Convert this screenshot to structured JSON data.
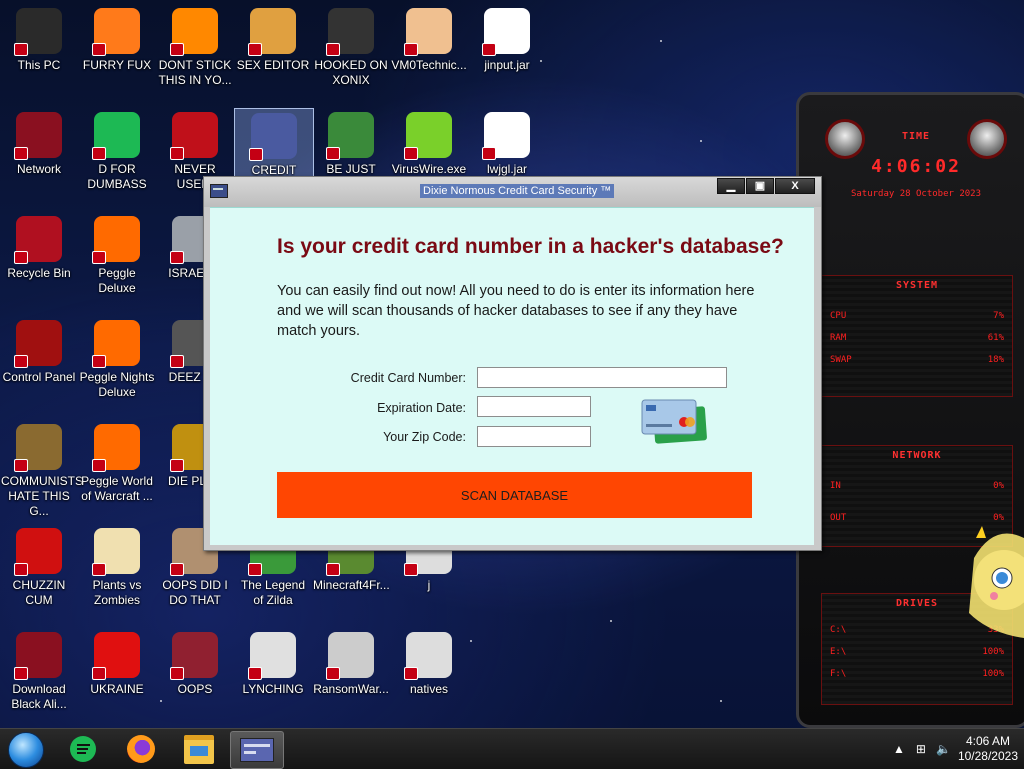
{
  "desktop": {
    "icons": [
      {
        "label": "This PC",
        "icon": "computer-icon",
        "color": "#2a2a2a"
      },
      {
        "label": "FURRY FUX",
        "icon": "firefox-icon",
        "color": "#ff7a1a"
      },
      {
        "label": "DONT STICK THIS IN YO...",
        "icon": "vlc-cone-icon",
        "color": "#ff8800"
      },
      {
        "label": "SEX EDITOR",
        "icon": "hxd-editor-icon",
        "color": "#e0a040"
      },
      {
        "label": "HOOKED ON XONIX",
        "icon": "xonix-game-icon",
        "color": "#333333"
      },
      {
        "label": "VM0Technic...",
        "icon": "doctor-person-icon",
        "color": "#f0c090"
      },
      {
        "label": "jinput.jar",
        "icon": "java-jar-icon",
        "color": "#ffffff"
      },
      {
        "label": "Network",
        "icon": "network-orb-icon",
        "color": "#8a1020"
      },
      {
        "label": "D FOR DUMBASS",
        "icon": "d-green-icon",
        "color": "#1db954"
      },
      {
        "label": "NEVER USED!",
        "icon": "dev-cpp-icon",
        "color": "#c0101a"
      },
      {
        "label": "CREDIT CARD CHECKER",
        "icon": "credit-card-checker-icon",
        "color": "#4a5aa0"
      },
      {
        "label": "BE JUST LIKE THE DUDE!",
        "icon": "santa-elf-icon",
        "color": "#3a8a3a"
      },
      {
        "label": "VirusWire.exe",
        "icon": "lime-wheel-icon",
        "color": "#7ad02a"
      },
      {
        "label": "lwjgl.jar",
        "icon": "java-jar-icon",
        "color": "#ffffff"
      },
      {
        "label": "Recycle Bin",
        "icon": "recycle-bin-icon",
        "color": "#b01020"
      },
      {
        "label": "Peggle Deluxe",
        "icon": "peggle-icon",
        "color": "#ff6a00"
      },
      {
        "label": "ISRAEL S",
        "icon": "gun-icon",
        "color": "#9aa0a8"
      },
      {
        "label": "Control Panel",
        "icon": "control-panel-icon",
        "color": "#a01010"
      },
      {
        "label": "Peggle Nights Deluxe",
        "icon": "peggle-nights-icon",
        "color": "#ff6a00"
      },
      {
        "label": "DEEZ NU",
        "icon": "layers-icon",
        "color": "#555555"
      },
      {
        "label": "COMMUNISTS HATE THIS G...",
        "icon": "money-bag-icon",
        "color": "#8a6a30"
      },
      {
        "label": "Peggle World of Warcraft ...",
        "icon": "peggle-wow-icon",
        "color": "#ff6a00"
      },
      {
        "label": "DIE PLEA",
        "icon": "de-logo-icon",
        "color": "#c09010"
      },
      {
        "label": "CHUZZIN CUM",
        "icon": "chuzzle-icon",
        "color": "#d01010"
      },
      {
        "label": "Plants vs Zombies",
        "icon": "flower-icon",
        "color": "#f0e0b0"
      },
      {
        "label": "OOPS DID I DO THAT",
        "icon": "portrait-icon",
        "color": "#b09070"
      },
      {
        "label": "The Legend of Zilda",
        "icon": "link-sprite-icon",
        "color": "#3a9a3a"
      },
      {
        "label": "Minecraft4Fr...",
        "icon": "minecraft-icon",
        "color": "#5a8a30"
      },
      {
        "label": "j",
        "icon": "file-icon",
        "color": "#dddddd"
      },
      {
        "label": "Download Black Ali...",
        "icon": "alien-orb-icon",
        "color": "#8a1020"
      },
      {
        "label": "UKRAINE",
        "icon": "radiation-icon",
        "color": "#e01010"
      },
      {
        "label": "OOPS",
        "icon": "card-icon",
        "color": "#902030"
      },
      {
        "label": "LYNCHING",
        "icon": "noose-icon",
        "color": "#e0e0e0"
      },
      {
        "label": "RansomWar...",
        "icon": "skull-icon",
        "color": "#cccccc"
      },
      {
        "label": "natives",
        "icon": "file-icon",
        "color": "#dddddd"
      }
    ]
  },
  "widget": {
    "time_title": "TIME",
    "time": "4:06:02",
    "date": "Saturday 28 October 2023",
    "system_title": "SYSTEM",
    "cpu_label": "CPU",
    "cpu_value": "7%",
    "ram_label": "RAM",
    "ram_value": "61%",
    "swap_label": "SWAP",
    "swap_value": "18%",
    "network_title": "NETWORK",
    "in_label": "IN",
    "in_value": "0%",
    "out_label": "OUT",
    "out_value": "0%",
    "drives_title": "DRIVES",
    "drive_c": "C:\\",
    "drive_c_value": "33%",
    "drive_e": "E:\\",
    "drive_e_value": "100%",
    "drive_f": "F:\\",
    "drive_f_value": "100%"
  },
  "dialog": {
    "title": "Dixie Normous Credit Card Security ™",
    "min_label": "▁",
    "max_label": "▣",
    "close_label": "X",
    "heading": "Is your credit card number in a hacker's database?",
    "description": "You can easily find out now! All you need to do is enter its information here and we will scan thousands of hacker databases to see if any they have match yours.",
    "fields": {
      "card_number_label": "Credit Card Number:",
      "card_number_value": "",
      "expiration_label": "Expiration Date:",
      "expiration_value": "",
      "zip_label": "Your Zip Code:",
      "zip_value": ""
    },
    "scan_button": "SCAN DATABASE"
  },
  "taskbar": {
    "items": [
      "start-orb-icon",
      "d-green-icon",
      "firefox-icon",
      "file-explorer-icon",
      "credit-card-checker-icon"
    ],
    "time": "4:06 AM",
    "date": "10/28/2023"
  },
  "colors": {
    "heading": "#7a0a14",
    "scan_button": "#ff4602",
    "dialog_bg": "#dcfaf6",
    "widget_red": "#ff2020"
  }
}
